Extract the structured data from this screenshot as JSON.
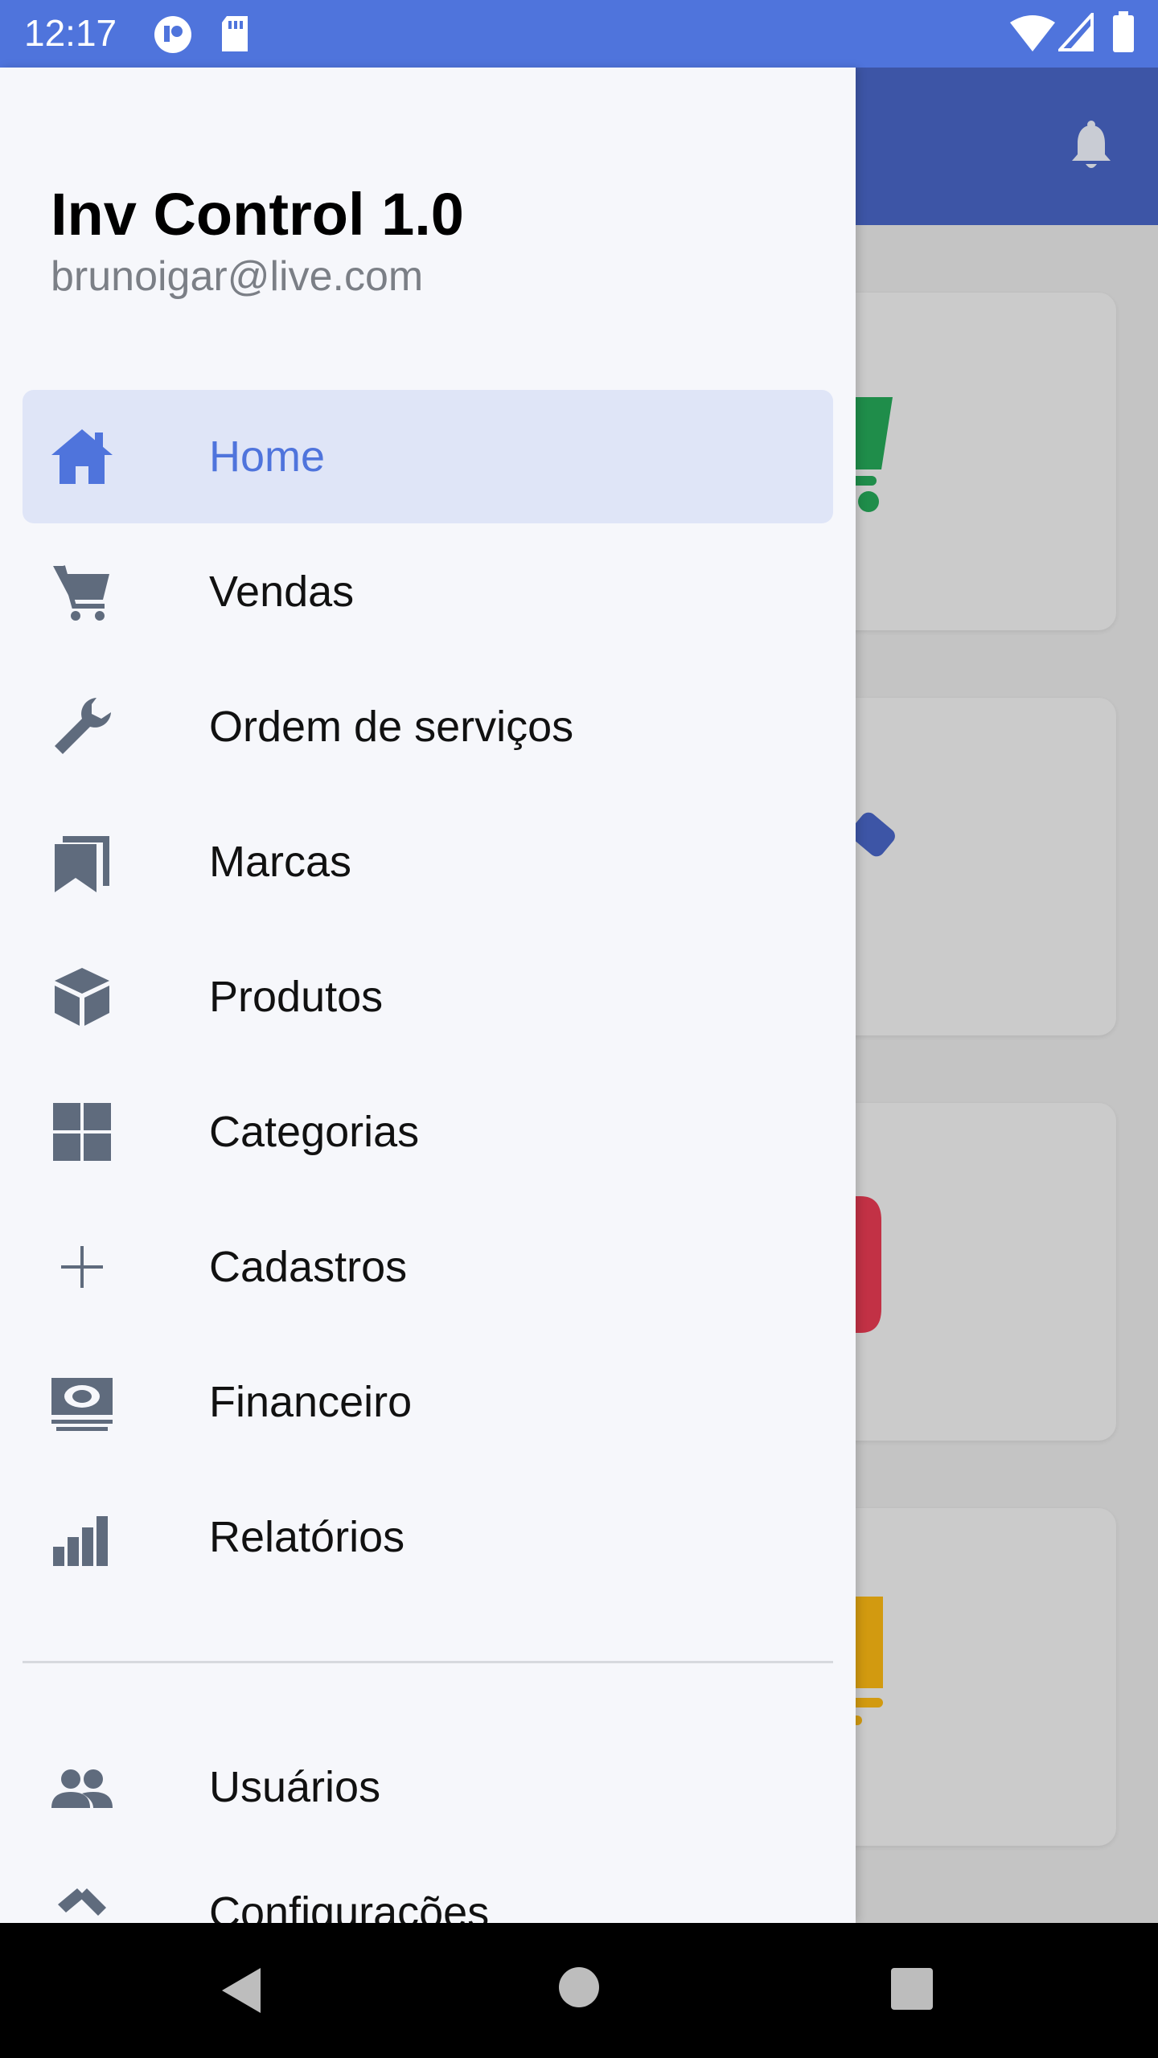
{
  "status_bar": {
    "time": "12:17"
  },
  "drawer": {
    "title": "Inv Control 1.0",
    "email": "brunoigar@live.com",
    "items": [
      {
        "label": "Home",
        "icon": "home-icon",
        "active": true
      },
      {
        "label": "Vendas",
        "icon": "cart-icon"
      },
      {
        "label": "Ordem de serviços",
        "icon": "wrench-icon"
      },
      {
        "label": "Marcas",
        "icon": "bookmarks-icon"
      },
      {
        "label": "Produtos",
        "icon": "cube-icon"
      },
      {
        "label": "Categorias",
        "icon": "grid-icon"
      },
      {
        "label": "Cadastros",
        "icon": "plus-icon"
      },
      {
        "label": "Financeiro",
        "icon": "money-icon"
      },
      {
        "label": "Relatórios",
        "icon": "bar-chart-icon"
      }
    ],
    "secondary_items": [
      {
        "label": "Usuários",
        "icon": "users-icon"
      },
      {
        "label": "Configurações",
        "icon": "tools-icon"
      }
    ]
  },
  "colors": {
    "accent": "#4f74dc",
    "header": "#3d55a6",
    "icon_gray": "#5f6b7d",
    "active_bg": "#dfe5f7"
  }
}
